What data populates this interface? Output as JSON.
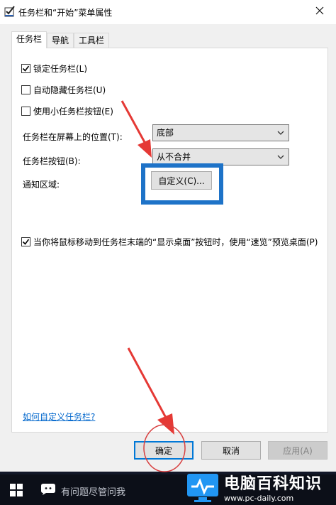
{
  "window": {
    "title": "任务栏和“开始”菜单属性"
  },
  "tabs": [
    {
      "label": "任务栏"
    },
    {
      "label": "导航"
    },
    {
      "label": "工具栏"
    }
  ],
  "taskbar_tab": {
    "lock": {
      "label": "锁定任务栏(L)",
      "checked": true
    },
    "autohide": {
      "label": "自动隐藏任务栏(U)",
      "checked": false
    },
    "small_buttons": {
      "label": "使用小任务栏按钮(E)",
      "checked": false
    },
    "position": {
      "label": "任务栏在屏幕上的位置(T):",
      "value": "底部"
    },
    "buttons": {
      "label": "任务栏按钮(B):",
      "value": "从不合并"
    },
    "notification": {
      "label": "通知区域:",
      "button_label": "自定义(C)..."
    },
    "peek": {
      "label": "当你将鼠标移动到任务栏末端的“显示桌面”按钮时，使用“速览”预览桌面(P)",
      "checked": true
    },
    "help_link": "如何自定义任务栏?"
  },
  "buttons": {
    "ok": "确定",
    "cancel": "取消",
    "apply": "应用(A)"
  },
  "desktop": {
    "search_placeholder": "有问题尽管问我"
  },
  "watermark": {
    "title": "电脑百科知识",
    "url": "www.pc-daily.com"
  },
  "colors": {
    "highlight_box": "#1e73c8",
    "annotation_red": "#e53935",
    "default_button_border": "#0078d7",
    "link": "#0066cc"
  }
}
